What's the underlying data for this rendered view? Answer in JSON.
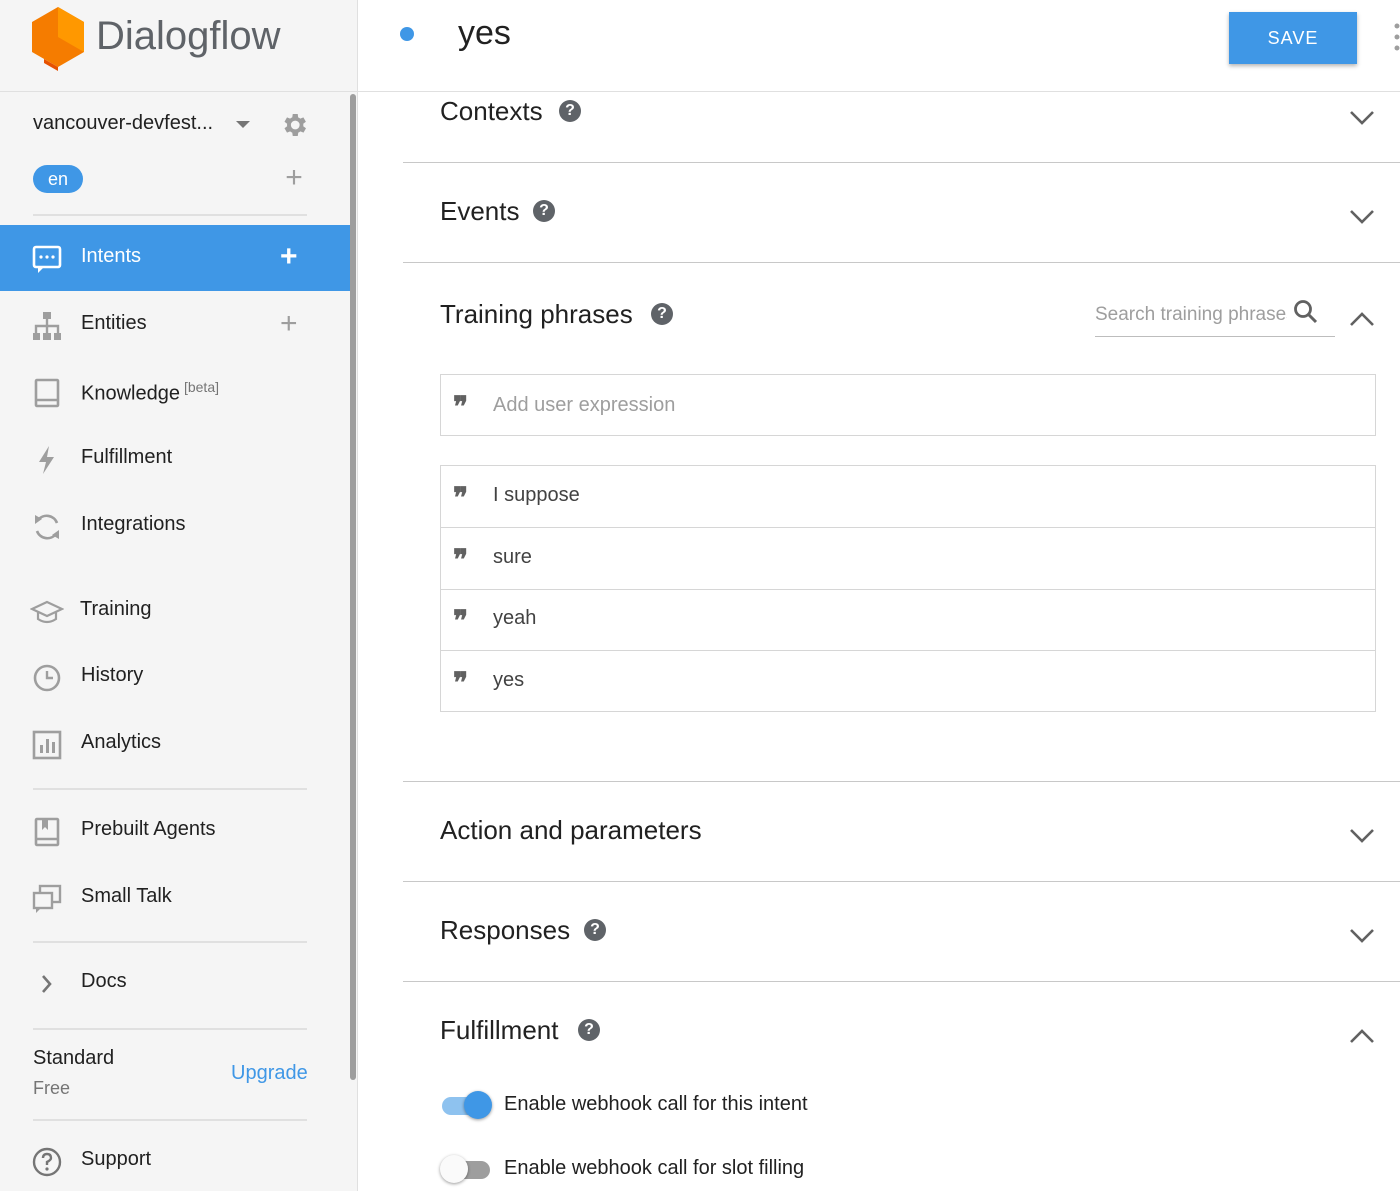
{
  "app": {
    "name": "Dialogflow",
    "brand_color": "#f57c00",
    "accent_color": "#3f97e6"
  },
  "sidebar": {
    "agent_name": "vancouver-devfest...",
    "language": "en",
    "items": [
      {
        "label": "Intents",
        "icon": "chat-icon",
        "active": true,
        "has_add": true
      },
      {
        "label": "Entities",
        "icon": "hierarchy-icon",
        "active": false,
        "has_add": true
      },
      {
        "label": "Knowledge",
        "badge": "[beta]",
        "icon": "book-icon",
        "active": false
      },
      {
        "label": "Fulfillment",
        "icon": "bolt-icon",
        "active": false
      },
      {
        "label": "Integrations",
        "icon": "sync-icon",
        "active": false
      },
      {
        "label": "Training",
        "icon": "graduation-cap-icon",
        "active": false
      },
      {
        "label": "History",
        "icon": "clock-icon",
        "active": false
      },
      {
        "label": "Analytics",
        "icon": "bar-chart-icon",
        "active": false
      },
      {
        "label": "Prebuilt Agents",
        "icon": "book-bookmark-icon",
        "active": false
      },
      {
        "label": "Small Talk",
        "icon": "chat-bubbles-icon",
        "active": false
      },
      {
        "label": "Docs",
        "icon": "chevron-right-icon",
        "active": false
      },
      {
        "label": "Support",
        "icon": "help-circle-icon",
        "active": false
      }
    ],
    "plan": {
      "name": "Standard",
      "tier": "Free",
      "upgrade_label": "Upgrade"
    }
  },
  "header": {
    "intent_name": "yes",
    "save_label": "SAVE"
  },
  "sections": {
    "contexts": {
      "title": "Contexts",
      "expanded": false
    },
    "events": {
      "title": "Events",
      "expanded": false
    },
    "training": {
      "title": "Training phrases",
      "expanded": true,
      "search_placeholder": "Search training phrases",
      "add_placeholder": "Add user expression",
      "phrases": [
        "I suppose",
        "sure",
        "yeah",
        "yes"
      ]
    },
    "action": {
      "title": "Action and parameters",
      "expanded": false
    },
    "responses": {
      "title": "Responses",
      "expanded": false
    },
    "fulfillment": {
      "title": "Fulfillment",
      "expanded": true,
      "webhook_intent_label": "Enable webhook call for this intent",
      "webhook_intent_on": true,
      "webhook_slot_label": "Enable webhook call for slot filling",
      "webhook_slot_on": false
    }
  },
  "help_glyph": "?"
}
